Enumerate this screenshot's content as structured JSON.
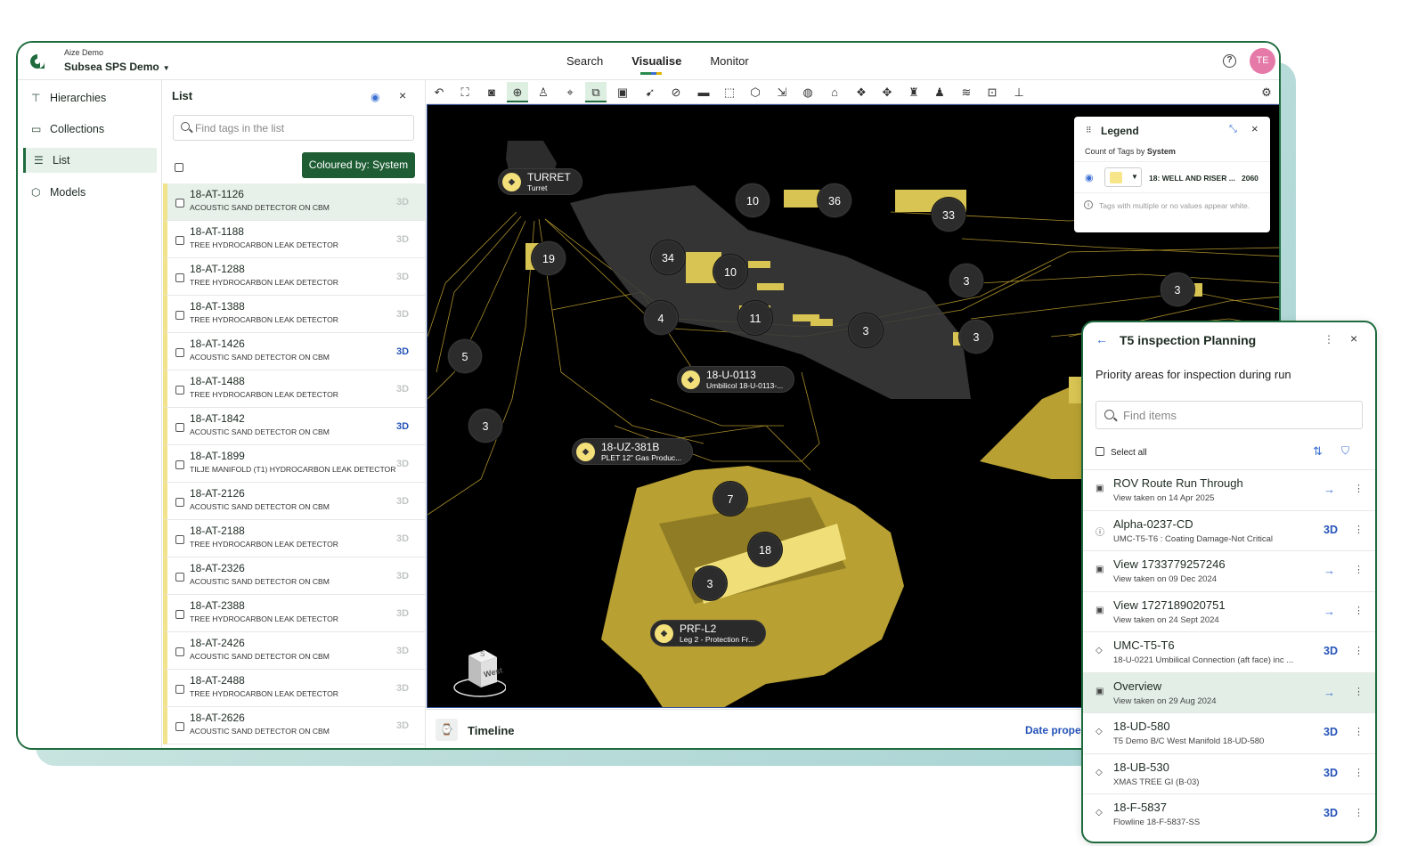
{
  "header": {
    "org": "Aize Demo",
    "project": "Subsea SPS Demo",
    "tabs": [
      "Search",
      "Visualise",
      "Monitor"
    ],
    "active_tab": "Visualise",
    "help_icon": "question-circle-icon",
    "avatar_initials": "TE"
  },
  "sidebar": {
    "items": [
      {
        "label": "Hierarchies",
        "icon": "hierarchy-icon"
      },
      {
        "label": "Collections",
        "icon": "folder-icon"
      },
      {
        "label": "List",
        "icon": "list-icon"
      },
      {
        "label": "Models",
        "icon": "cube-icon"
      }
    ],
    "active": "List"
  },
  "list": {
    "title": "List",
    "search_placeholder": "Find tags in the list",
    "coloured_by": "Coloured by: System",
    "rows": [
      {
        "tag": "18-AT-1126",
        "desc": "ACOUSTIC SAND DETECTOR ON CBM",
        "badge": "3D",
        "active": false
      },
      {
        "tag": "18-AT-1188",
        "desc": "TREE HYDROCARBON LEAK DETECTOR",
        "badge": "3D",
        "active": false
      },
      {
        "tag": "18-AT-1288",
        "desc": "TREE HYDROCARBON LEAK DETECTOR",
        "badge": "3D",
        "active": false
      },
      {
        "tag": "18-AT-1388",
        "desc": "TREE HYDROCARBON LEAK DETECTOR",
        "badge": "3D",
        "active": false
      },
      {
        "tag": "18-AT-1426",
        "desc": "ACOUSTIC SAND DETECTOR ON CBM",
        "badge": "3D",
        "active": true
      },
      {
        "tag": "18-AT-1488",
        "desc": "TREE HYDROCARBON LEAK DETECTOR",
        "badge": "3D",
        "active": false
      },
      {
        "tag": "18-AT-1842",
        "desc": "ACOUSTIC SAND DETECTOR ON CBM",
        "badge": "3D",
        "active": true
      },
      {
        "tag": "18-AT-1899",
        "desc": "TILJE MANIFOLD (T1) HYDROCARBON LEAK DETECTOR",
        "badge": "3D",
        "active": false
      },
      {
        "tag": "18-AT-2126",
        "desc": "ACOUSTIC SAND DETECTOR ON CBM",
        "badge": "3D",
        "active": false
      },
      {
        "tag": "18-AT-2188",
        "desc": "TREE HYDROCARBON LEAK DETECTOR",
        "badge": "3D",
        "active": false
      },
      {
        "tag": "18-AT-2326",
        "desc": "ACOUSTIC SAND DETECTOR ON CBM",
        "badge": "3D",
        "active": false
      },
      {
        "tag": "18-AT-2388",
        "desc": "TREE HYDROCARBON LEAK DETECTOR",
        "badge": "3D",
        "active": false
      },
      {
        "tag": "18-AT-2426",
        "desc": "ACOUSTIC SAND DETECTOR ON CBM",
        "badge": "3D",
        "active": false
      },
      {
        "tag": "18-AT-2488",
        "desc": "TREE HYDROCARBON LEAK DETECTOR",
        "badge": "3D",
        "active": false
      },
      {
        "tag": "18-AT-2626",
        "desc": "ACOUSTIC SAND DETECTOR ON CBM",
        "badge": "3D",
        "active": false
      }
    ]
  },
  "toolbar": {
    "tools": [
      "undo-icon",
      "fit-view-icon",
      "camera-icon",
      "target-icon",
      "person-icon",
      "focus-icon",
      "box-select-icon",
      "scan-icon",
      "pointer-icon",
      "hide-icon",
      "ruler-icon",
      "select-area-icon",
      "cube-icon",
      "export-icon",
      "palette-icon",
      "tag-icon",
      "model-icon",
      "move-icon",
      "cone-icon",
      "figure-icon",
      "route-icon",
      "zoom-box-icon",
      "axis-icon",
      "settings-icon"
    ]
  },
  "viewer": {
    "clusters": [
      "10",
      "36",
      "33",
      "19",
      "34",
      "10",
      "4",
      "11",
      "3",
      "3",
      "3",
      "5",
      "3",
      "7",
      "18",
      "3"
    ],
    "tags": [
      {
        "title": "TURRET",
        "subtitle": "Turret"
      },
      {
        "title": "18-U-0113",
        "subtitle": "Umbilicol 18-U-0113-..."
      },
      {
        "title": "18-UZ-381B",
        "subtitle": "PLET 12\" Gas Produc..."
      },
      {
        "title": "PRF-L2",
        "subtitle": "Leg 2 - Protection Fr..."
      }
    ],
    "navcube_top": "S",
    "navcube_face": "West"
  },
  "legend": {
    "title": "Legend",
    "subtitle_prefix": "Count of Tags by",
    "subtitle_field": "System",
    "item_name": "18: WELL AND RISER ...",
    "item_count": "2060",
    "swatch_color": "#f7e58a",
    "note": "Tags with multiple or no values appear white."
  },
  "timeline": {
    "label": "Timeline",
    "date_text": "Date proper"
  },
  "inspection": {
    "title": "T5 inspection Planning",
    "description": "Priority areas for inspection during run",
    "search_placeholder": "Find items",
    "select_all": "Select all",
    "items": [
      {
        "title": "ROV Route Run Through",
        "sub": "View taken on 14 Apr 2025",
        "action": "→",
        "icon": "view-icon"
      },
      {
        "title": "Alpha-0237-CD",
        "sub": "UMC-T5-T6 : Coating Damage-Not Critical",
        "action": "3D",
        "icon": "alert-icon"
      },
      {
        "title": "View 1733779257246",
        "sub": "View taken on 09 Dec 2024",
        "action": "→",
        "icon": "view-icon"
      },
      {
        "title": "View 1727189020751",
        "sub": "View taken on 24 Sept 2024",
        "action": "→",
        "icon": "view-icon"
      },
      {
        "title": "UMC-T5-T6",
        "sub": "18-U-0221 Umbilical Connection (aft face) inc ...",
        "action": "3D",
        "icon": "tag-icon"
      },
      {
        "title": "Overview",
        "sub": "View taken on 29 Aug 2024",
        "action": "→",
        "icon": "view-icon"
      },
      {
        "title": "18-UD-580",
        "sub": "T5 Demo B/C West Manifold 18-UD-580",
        "action": "3D",
        "icon": "tag-icon"
      },
      {
        "title": "18-UB-530",
        "sub": "XMAS TREE GI (B-03)",
        "action": "3D",
        "icon": "tag-icon"
      },
      {
        "title": "18-F-5837",
        "sub": "Flowline 18-F-5837-SS",
        "action": "3D",
        "icon": "tag-icon"
      }
    ]
  },
  "colors": {
    "brand": "#1f6b3e",
    "accent_blue": "#2553b8",
    "highlight_yellow": "#f3e07a",
    "model_gold": "#b8a032"
  }
}
